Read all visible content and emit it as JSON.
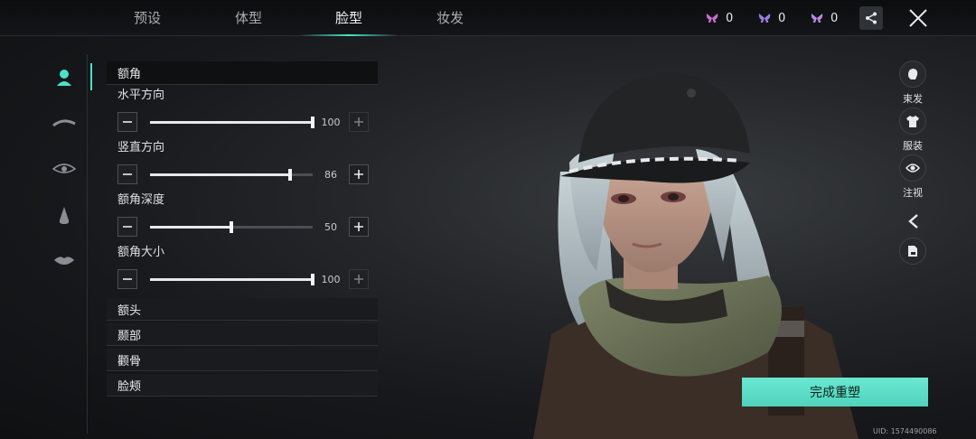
{
  "tabs": [
    {
      "label": "预设"
    },
    {
      "label": "体型"
    },
    {
      "label": "脸型",
      "active": true
    },
    {
      "label": "妆发"
    }
  ],
  "currencies": [
    {
      "icon": "butterfly-pink-icon",
      "value": "0",
      "color": "#c86fd1"
    },
    {
      "icon": "butterfly-purple-icon",
      "value": "0",
      "color": "#9a7de6"
    },
    {
      "icon": "butterfly-violet-icon",
      "value": "0",
      "color": "#b88be0"
    }
  ],
  "rail": [
    "face-icon",
    "eyebrow-icon",
    "eye-icon",
    "nose-icon",
    "lips-icon"
  ],
  "panel": {
    "section_title": "额角",
    "sliders": [
      {
        "label": "水平方向",
        "value": "100",
        "fraction": 1.0
      },
      {
        "label": "竖直方向",
        "value": "86",
        "fraction": 0.86
      },
      {
        "label": "额角深度",
        "value": "50",
        "fraction": 0.5
      },
      {
        "label": "额角大小",
        "value": "100",
        "fraction": 1.0
      }
    ],
    "collapsed_sections": [
      "额头",
      "颞部",
      "颧骨",
      "脸颊"
    ]
  },
  "tools": [
    {
      "icon": "hair-icon",
      "label": "束发"
    },
    {
      "icon": "clothing-icon",
      "label": "服装"
    },
    {
      "icon": "gaze-eye-icon",
      "label": "注视"
    }
  ],
  "confirm_label": "完成重塑",
  "uid": "UID: 1574490086",
  "accent": "#49e6c8"
}
